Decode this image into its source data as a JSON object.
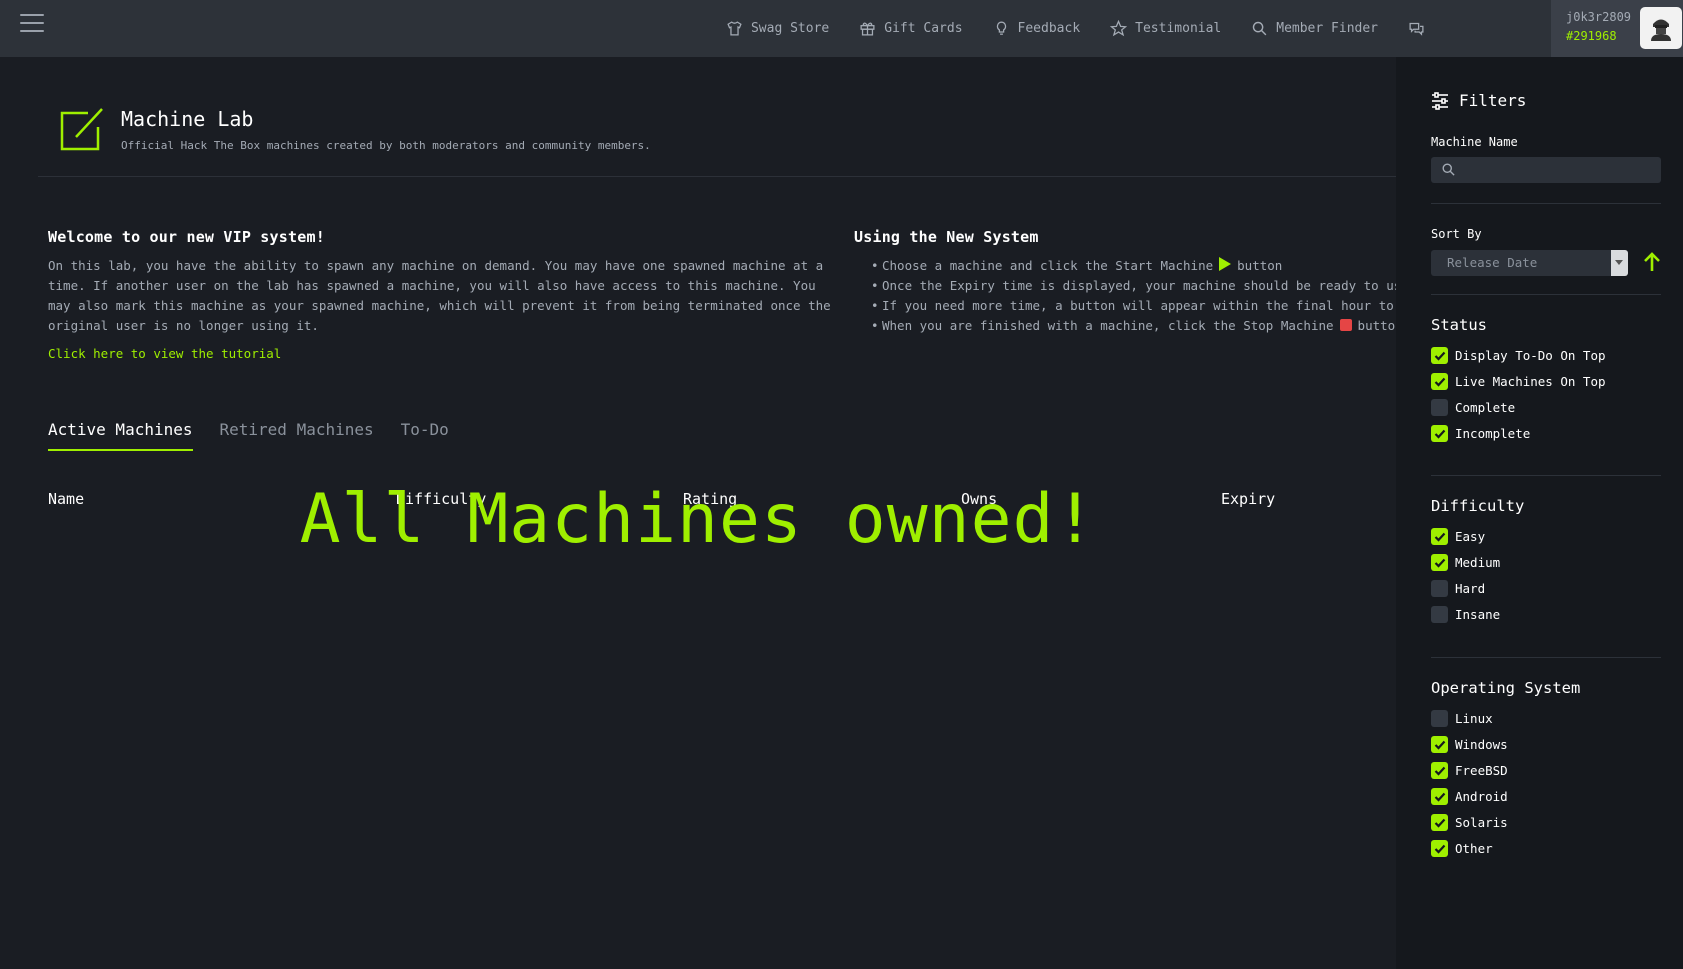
{
  "topbar": {
    "nav": [
      {
        "label": "Swag Store",
        "icon": "shirt-icon"
      },
      {
        "label": "Gift Cards",
        "icon": "gift-icon"
      },
      {
        "label": "Feedback",
        "icon": "lightbulb-icon"
      },
      {
        "label": "Testimonial",
        "icon": "star-icon"
      },
      {
        "label": "Member Finder",
        "icon": "search-icon"
      }
    ],
    "chat_icon": "chat-icon",
    "username": "j0k3r2809",
    "user_id": "#291968"
  },
  "header": {
    "title": "Machine Lab",
    "subtitle": "Official Hack The Box machines created by both moderators and community members."
  },
  "intro": {
    "left_title": "Welcome to our new VIP system!",
    "left_text": "On this lab, you have the ability to spawn any machine on demand. You may have one spawned machine at a time. If another user on the lab has spawned a machine, you will also have access to this machine. You may also mark this machine as your spawned machine, which will prevent it from being terminated once the original user is no longer using it.",
    "tutorial_link": "Click here to view the tutorial",
    "right_title": "Using the New System",
    "steps": {
      "s1_a": "Choose a machine and click the Start Machine",
      "s1_b": "button",
      "s2": "Once the Expiry time is displayed, your machine should be ready to use",
      "s3": "If you need more time, a button will appear within the final hour to ext",
      "s4_a": "When you are finished with a machine, click the Stop Machine",
      "s4_b": "button"
    }
  },
  "tabs": [
    "Active Machines",
    "Retired Machines",
    "To-Do"
  ],
  "table": {
    "columns": [
      "Name",
      "Difficulty",
      "Rating",
      "Owns",
      "Expiry"
    ],
    "empty_message": "All Machines owned!"
  },
  "filters": {
    "title": "Filters",
    "machine_name_label": "Machine Name",
    "machine_name_value": "",
    "sort_by_label": "Sort By",
    "sort_by_value": "Release Date",
    "status_title": "Status",
    "status": [
      {
        "label": "Display To-Do On Top",
        "checked": true
      },
      {
        "label": "Live Machines On Top",
        "checked": true
      },
      {
        "label": "Complete",
        "checked": false
      },
      {
        "label": "Incomplete",
        "checked": true
      }
    ],
    "difficulty_title": "Difficulty",
    "difficulty": [
      {
        "label": "Easy",
        "checked": true
      },
      {
        "label": "Medium",
        "checked": true
      },
      {
        "label": "Hard",
        "checked": false
      },
      {
        "label": "Insane",
        "checked": false
      }
    ],
    "os_title": "Operating System",
    "os": [
      {
        "label": "Linux",
        "checked": false
      },
      {
        "label": "Windows",
        "checked": true
      },
      {
        "label": "FreeBSD",
        "checked": true
      },
      {
        "label": "Android",
        "checked": true
      },
      {
        "label": "Solaris",
        "checked": true
      },
      {
        "label": "Other",
        "checked": true
      }
    ]
  },
  "colors": {
    "accent": "#9fef00",
    "stop": "#e54545",
    "bg": "#1a1d23",
    "sidebar": "#15181d",
    "topbar": "#2d3239"
  }
}
